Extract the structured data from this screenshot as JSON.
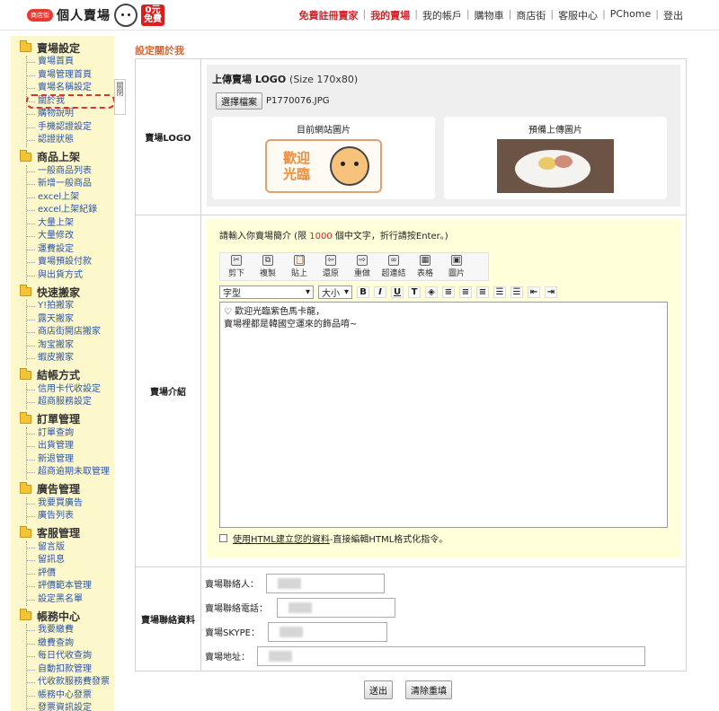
{
  "header": {
    "logo_badge": "商店街",
    "brand": "個人賣場",
    "zero_badge": "0元\n免費",
    "nav": [
      {
        "label": "免費註冊賣家",
        "red": true
      },
      {
        "label": "我的賣場",
        "red": true
      },
      {
        "label": "我的帳戶",
        "red": false
      },
      {
        "label": "購物車",
        "red": false
      },
      {
        "label": "商店街",
        "red": false
      },
      {
        "label": "客服中心",
        "red": false
      },
      {
        "label": "PChome",
        "red": false
      },
      {
        "label": "登出",
        "red": false
      }
    ]
  },
  "sidebar": {
    "collapse_tab": "關閉",
    "groups": [
      {
        "title": "賣場設定",
        "items": [
          "賣場首頁",
          "賣場管理首頁",
          "賣場名稱設定",
          "關於我",
          "購物說明",
          "手機認證設定",
          "認證狀態"
        ]
      },
      {
        "title": "商品上架",
        "items": [
          "一般商品列表",
          "新增一般商品",
          "excel上架",
          "excel上架紀錄",
          "大量上架",
          "大量修改",
          "運費設定",
          "賣場預設付款",
          "與出貨方式"
        ]
      },
      {
        "title": "快速搬家",
        "items": [
          "Y!拍搬家",
          "露天搬家",
          "商店街開店搬家",
          "淘宝搬家",
          "蝦皮搬家"
        ]
      },
      {
        "title": "結帳方式",
        "items": [
          "信用卡代收設定",
          "超商服務設定"
        ]
      },
      {
        "title": "訂單管理",
        "items": [
          "訂單查詢",
          "出貨管理",
          "新退管理",
          "超商逾期未取管理"
        ]
      },
      {
        "title": "廣告管理",
        "items": [
          "我要買廣告",
          "廣告列表"
        ]
      },
      {
        "title": "客服管理",
        "items": [
          "留言版",
          "留訊息",
          "評價",
          "評價範本管理",
          "設定黑名單"
        ]
      },
      {
        "title": "帳務中心",
        "items": [
          "我要繳費",
          "繳費查詢",
          "每日代收查詢",
          "自動扣款管理",
          "代收款服務費發票",
          "帳務中心發票",
          "發票資訊設定"
        ]
      }
    ],
    "active_item": "關於我"
  },
  "main": {
    "page_title": "設定關於我",
    "logo_section": {
      "label": "賣場LOGO",
      "upload_title": "上傳賣場 LOGO",
      "upload_size": "(Size 170x80)",
      "choose_file_button": "選擇檔案",
      "file_name": "P1770076.JPG",
      "current_label": "目前網站圖片",
      "current_image_text": "歡迎\n光臨",
      "preview_label": "預備上傳圖片"
    },
    "intro_section": {
      "label": "賣場介紹",
      "hint_prefix": "請輸入你賣場簡介 (限 ",
      "hint_limit": "1000",
      "hint_suffix": " 個中文字，折行請按Enter。)",
      "toolbar": [
        "剪下",
        "複製",
        "貼上",
        "還原",
        "重做",
        "超連結",
        "表格",
        "圖片"
      ],
      "font_select": "字型",
      "size_select": "大小",
      "editor_lines": [
        "♡ 歡迎光臨紫色馬卡龍，",
        "賣場裡都是韓國空運來的飾品唷~"
      ],
      "html_option_link": "使用HTML建立您的資料",
      "html_option_rest": "-直接編輯HTML格式化指令。"
    },
    "contact_section": {
      "label": "賣場聯絡資料",
      "fields": [
        "賣場聯絡人：",
        "賣場聯絡電話：",
        "賣場SKYPE：",
        "賣場地址："
      ]
    },
    "buttons": {
      "submit": "送出",
      "reset": "清除重填"
    }
  }
}
